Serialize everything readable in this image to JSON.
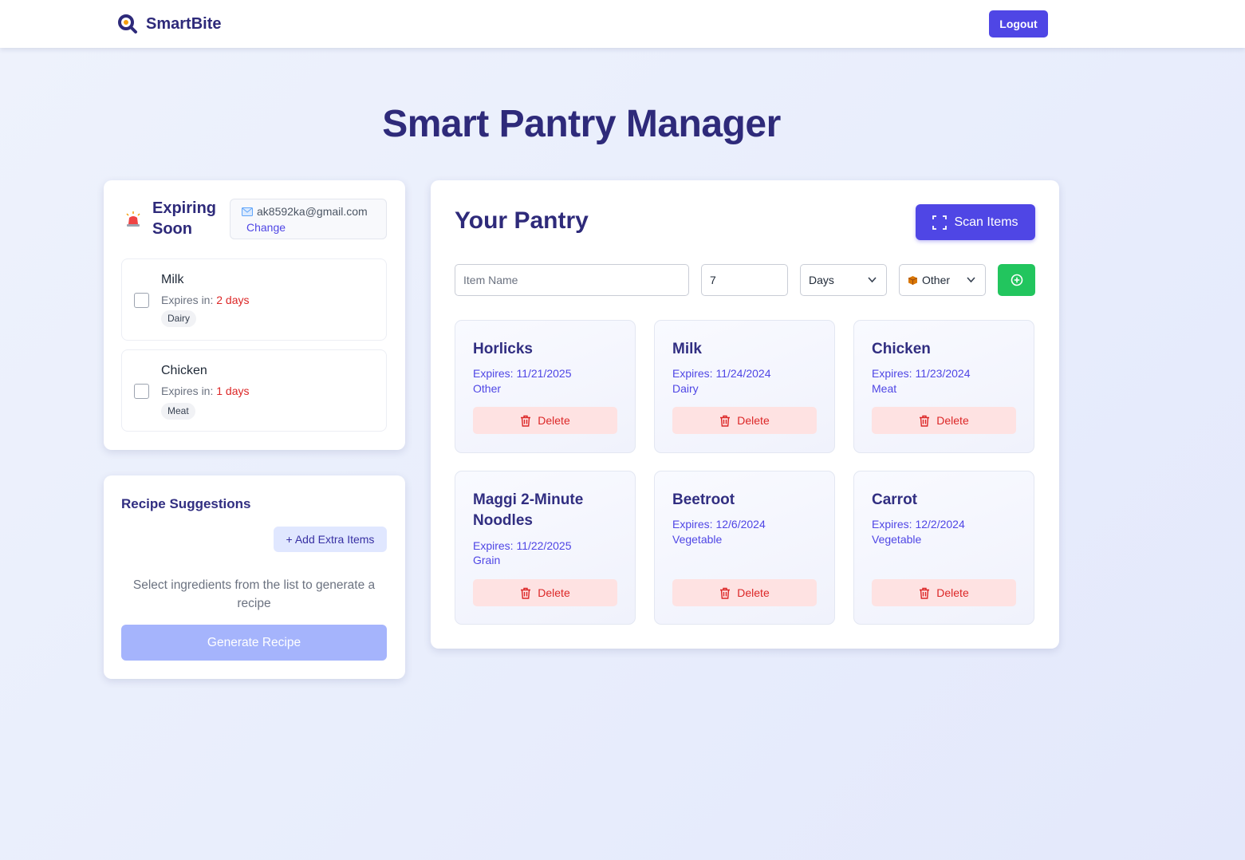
{
  "header": {
    "brand": "SmartBite",
    "logout_label": "Logout"
  },
  "page_title": "Smart Pantry Manager",
  "expiring": {
    "title": "Expiring Soon",
    "email": "ak8592ka@gmail.com",
    "change_label": "Change",
    "expires_label": "Expires in: ",
    "items": [
      {
        "name": "Milk",
        "days": "2 days",
        "category": "Dairy"
      },
      {
        "name": "Chicken",
        "days": "1 days",
        "category": "Meat"
      }
    ]
  },
  "recipes": {
    "title": "Recipe Suggestions",
    "add_extra_label": "+ Add Extra Items",
    "hint": "Select ingredients from the list to generate a recipe",
    "generate_label": "Generate Recipe"
  },
  "pantry": {
    "title": "Your Pantry",
    "scan_label": "Scan Items",
    "item_name_placeholder": "Item Name",
    "quantity_value": "7",
    "unit_value": "Days",
    "category_value": "Other",
    "delete_label": "Delete",
    "items": [
      {
        "name": "Horlicks",
        "expires": "Expires: 11/21/2025",
        "category": "Other"
      },
      {
        "name": "Milk",
        "expires": "Expires: 11/24/2024",
        "category": "Dairy"
      },
      {
        "name": "Chicken",
        "expires": "Expires: 11/23/2024",
        "category": "Meat"
      },
      {
        "name": "Maggi 2-Minute Noodles",
        "expires": "Expires: 11/22/2025",
        "category": "Grain"
      },
      {
        "name": "Beetroot",
        "expires": "Expires: 12/6/2024",
        "category": "Vegetable"
      },
      {
        "name": "Carrot",
        "expires": "Expires: 12/2/2024",
        "category": "Vegetable"
      }
    ]
  },
  "colors": {
    "primary": "#4f46e5",
    "title": "#2e2a7a",
    "success": "#22c55e",
    "danger": "#dc2626",
    "danger_bg": "#fee2e2"
  }
}
